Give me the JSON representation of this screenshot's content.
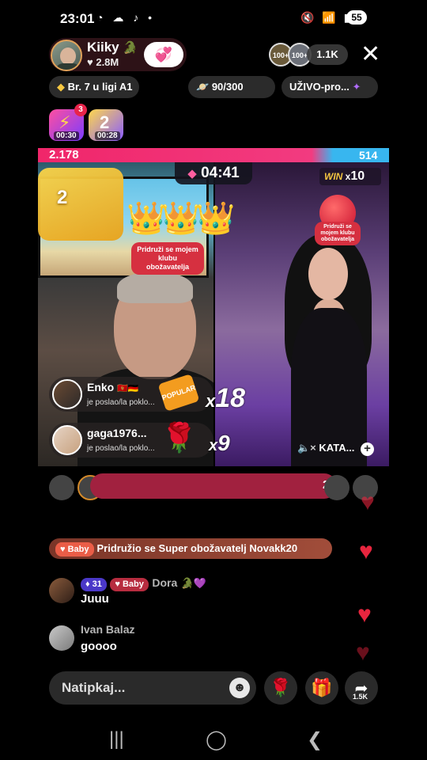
{
  "status": {
    "time": "23:01",
    "battery": "55"
  },
  "host": {
    "name": "Kiiky",
    "likes": "2.8M"
  },
  "viewers": {
    "badge1": "100+",
    "badge2": "100+",
    "count": "1.1K"
  },
  "chips": {
    "rank": "Br. 7 u ligi A1",
    "progress": "90/300",
    "live_tag": "UŽIVO-pro..."
  },
  "badges": {
    "count": "3",
    "timer1": "00:30",
    "timer2": "00:28"
  },
  "battle": {
    "score_left": "2.178",
    "score_right": "514",
    "timer": "04:41",
    "win_label": "WIN",
    "win_mult": "10",
    "trophy_number": "2",
    "club_left": "Pridruži se mojem klubu obožavatelja",
    "club_right": "Pridruži se mojem klubu obožavatelja",
    "opponent_name": "KATA..."
  },
  "gifts": [
    {
      "user": "Enko",
      "flags": "🇲🇪🇩🇪",
      "sub": "je poslao/la poklo...",
      "mult": "18",
      "gift_label": "POPULAR"
    },
    {
      "user": "gaga1976...",
      "sub": "je poslao/la poklo...",
      "mult": "9"
    }
  ],
  "contribution": {
    "value": "2"
  },
  "join_banner": {
    "tag": "Baby",
    "text": "Pridružio se Super obožavatelj Novakk20"
  },
  "chat": [
    {
      "level": "31",
      "tag": "Baby",
      "name": "Dora",
      "message": "Juuu"
    },
    {
      "name": "Ivan Balaz",
      "message": "goooo"
    }
  ],
  "composer": {
    "placeholder": "Natipkaj...",
    "share_count": "1.5K"
  },
  "icons": {
    "close": "close-icon",
    "share": "share-icon",
    "gift": "gift-icon",
    "rose": "rose-icon",
    "emoji": "emoji-icon"
  },
  "colors": {
    "accent_pink": "#f0266a",
    "accent_blue": "#38b6ef",
    "heart_red": "#e8253e"
  }
}
